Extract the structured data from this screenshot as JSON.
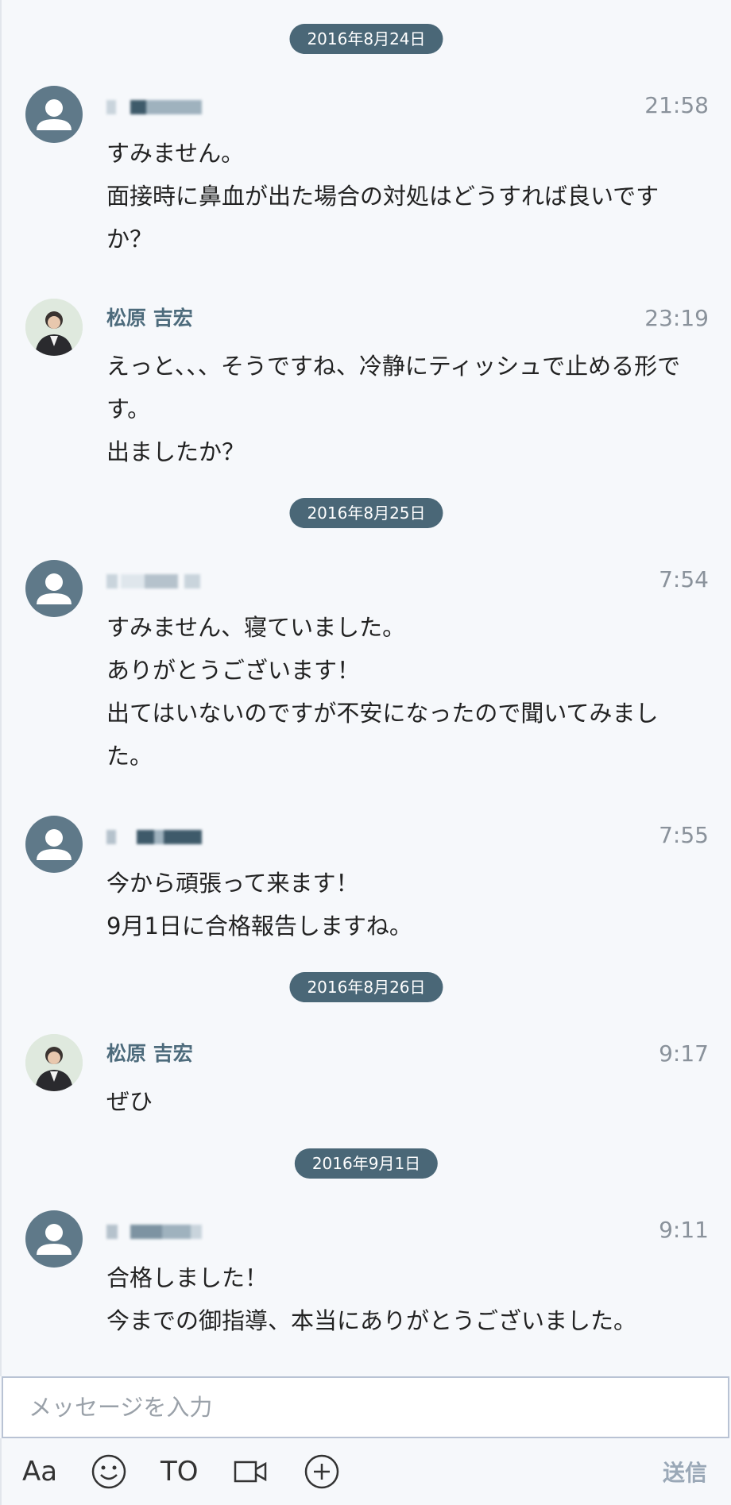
{
  "dates": [
    "2016年8月24日",
    "2016年8月25日",
    "2016年8月26日",
    "2016年9月1日"
  ],
  "messages": [
    {
      "sender": "",
      "time": "21:58",
      "lines": [
        "すみません。",
        "面接時に鼻血が出た場合の対処はどうすれば良いですか？"
      ]
    },
    {
      "sender": "松原 吉宏",
      "time": "23:19",
      "lines": [
        "えっと、、、そうですね、冷静にティッシュで止める形です。",
        "出ましたか？"
      ]
    },
    {
      "sender": "",
      "time": "7:54",
      "lines": [
        "すみません、寝ていました。",
        "ありがとうございます！",
        "出てはいないのですが不安になったので聞いてみました。"
      ]
    },
    {
      "sender": "",
      "time": "7:55",
      "lines": [
        "今から頑張って来ます！",
        "9月1日に合格報告しますね。"
      ]
    },
    {
      "sender": "松原 吉宏",
      "time": "9:17",
      "lines": [
        "ぜひ"
      ]
    },
    {
      "sender": "",
      "time": "9:11",
      "lines": [
        "合格しました！",
        "今までの御指導、本当にありがとうございました。"
      ]
    }
  ],
  "composer": {
    "placeholder": "メッセージを入力"
  },
  "toolbar": {
    "font_label": "Aa",
    "to_label": "TO",
    "send_label": "送信",
    "icons": [
      "font-size-icon",
      "emoji-icon",
      "to-mention",
      "video-icon",
      "add-icon"
    ]
  },
  "colors": {
    "date_pill": "#4a6777",
    "sender_name": "#4d6b7c",
    "avatar_default": "#5f7989",
    "send": "#9aa8b7"
  }
}
